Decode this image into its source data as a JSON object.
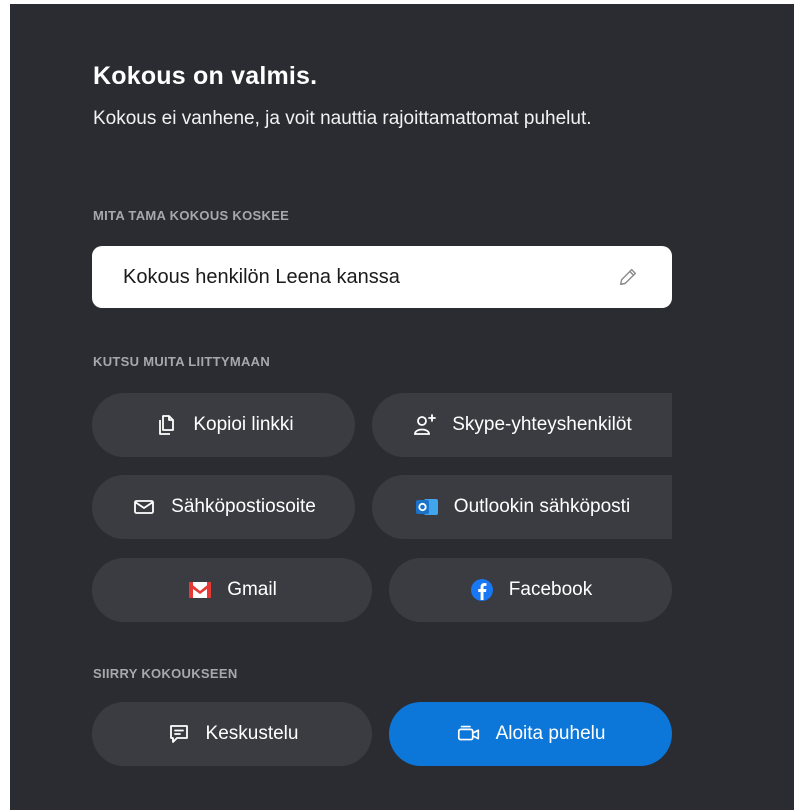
{
  "header": {
    "title": "Kokous on valmis.",
    "subtitle": "Kokous ei vanhene, ja voit nauttia rajoittamattomat puhelut."
  },
  "topic": {
    "label": "MITA TAMA KOKOUS KOSKEE",
    "value": "Kokous henkilön Leena kanssa",
    "icon": "pencil-icon"
  },
  "invite": {
    "label": "KUTSU MUITA LIITTYMAAN",
    "buttons": [
      {
        "label": "Kopioi linkki",
        "icon": "copy-icon"
      },
      {
        "label": "Skype-yhteyshenkilöt",
        "icon": "add-person-icon"
      },
      {
        "label": "Sähköpostiosoite",
        "icon": "mail-icon"
      },
      {
        "label": "Outlookin sähköposti",
        "icon": "outlook-icon"
      },
      {
        "label": "Gmail",
        "icon": "gmail-icon"
      },
      {
        "label": "Facebook",
        "icon": "facebook-icon"
      }
    ]
  },
  "meeting": {
    "label": "SIIRRY KOKOUKSEEN",
    "buttons": [
      {
        "label": "Keskustelu",
        "icon": "chat-icon"
      },
      {
        "label": "Aloita puhelu",
        "icon": "video-call-icon"
      }
    ]
  },
  "colors": {
    "background": "#2b2c31",
    "button": "#3b3c42",
    "primary": "#0d77d9",
    "outlook": "#1a73c8",
    "gmail_red": "#e53935",
    "facebook": "#1877f2"
  }
}
